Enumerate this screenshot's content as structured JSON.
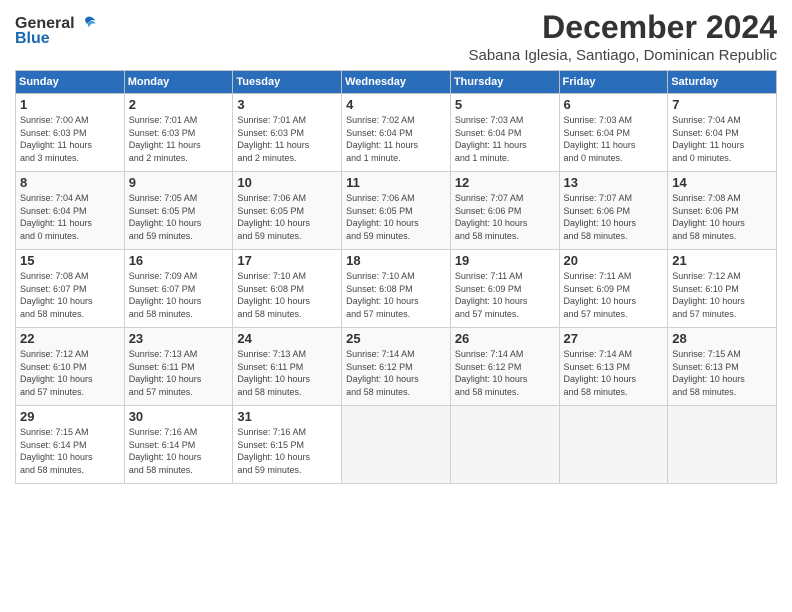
{
  "logo": {
    "general": "General",
    "blue": "Blue"
  },
  "title": "December 2024",
  "subtitle": "Sabana Iglesia, Santiago, Dominican Republic",
  "headers": [
    "Sunday",
    "Monday",
    "Tuesday",
    "Wednesday",
    "Thursday",
    "Friday",
    "Saturday"
  ],
  "weeks": [
    [
      {
        "day": "1",
        "info": "Sunrise: 7:00 AM\nSunset: 6:03 PM\nDaylight: 11 hours\nand 3 minutes."
      },
      {
        "day": "2",
        "info": "Sunrise: 7:01 AM\nSunset: 6:03 PM\nDaylight: 11 hours\nand 2 minutes."
      },
      {
        "day": "3",
        "info": "Sunrise: 7:01 AM\nSunset: 6:03 PM\nDaylight: 11 hours\nand 2 minutes."
      },
      {
        "day": "4",
        "info": "Sunrise: 7:02 AM\nSunset: 6:04 PM\nDaylight: 11 hours\nand 1 minute."
      },
      {
        "day": "5",
        "info": "Sunrise: 7:03 AM\nSunset: 6:04 PM\nDaylight: 11 hours\nand 1 minute."
      },
      {
        "day": "6",
        "info": "Sunrise: 7:03 AM\nSunset: 6:04 PM\nDaylight: 11 hours\nand 0 minutes."
      },
      {
        "day": "7",
        "info": "Sunrise: 7:04 AM\nSunset: 6:04 PM\nDaylight: 11 hours\nand 0 minutes."
      }
    ],
    [
      {
        "day": "8",
        "info": "Sunrise: 7:04 AM\nSunset: 6:04 PM\nDaylight: 11 hours\nand 0 minutes."
      },
      {
        "day": "9",
        "info": "Sunrise: 7:05 AM\nSunset: 6:05 PM\nDaylight: 10 hours\nand 59 minutes."
      },
      {
        "day": "10",
        "info": "Sunrise: 7:06 AM\nSunset: 6:05 PM\nDaylight: 10 hours\nand 59 minutes."
      },
      {
        "day": "11",
        "info": "Sunrise: 7:06 AM\nSunset: 6:05 PM\nDaylight: 10 hours\nand 59 minutes."
      },
      {
        "day": "12",
        "info": "Sunrise: 7:07 AM\nSunset: 6:06 PM\nDaylight: 10 hours\nand 58 minutes."
      },
      {
        "day": "13",
        "info": "Sunrise: 7:07 AM\nSunset: 6:06 PM\nDaylight: 10 hours\nand 58 minutes."
      },
      {
        "day": "14",
        "info": "Sunrise: 7:08 AM\nSunset: 6:06 PM\nDaylight: 10 hours\nand 58 minutes."
      }
    ],
    [
      {
        "day": "15",
        "info": "Sunrise: 7:08 AM\nSunset: 6:07 PM\nDaylight: 10 hours\nand 58 minutes."
      },
      {
        "day": "16",
        "info": "Sunrise: 7:09 AM\nSunset: 6:07 PM\nDaylight: 10 hours\nand 58 minutes."
      },
      {
        "day": "17",
        "info": "Sunrise: 7:10 AM\nSunset: 6:08 PM\nDaylight: 10 hours\nand 58 minutes."
      },
      {
        "day": "18",
        "info": "Sunrise: 7:10 AM\nSunset: 6:08 PM\nDaylight: 10 hours\nand 57 minutes."
      },
      {
        "day": "19",
        "info": "Sunrise: 7:11 AM\nSunset: 6:09 PM\nDaylight: 10 hours\nand 57 minutes."
      },
      {
        "day": "20",
        "info": "Sunrise: 7:11 AM\nSunset: 6:09 PM\nDaylight: 10 hours\nand 57 minutes."
      },
      {
        "day": "21",
        "info": "Sunrise: 7:12 AM\nSunset: 6:10 PM\nDaylight: 10 hours\nand 57 minutes."
      }
    ],
    [
      {
        "day": "22",
        "info": "Sunrise: 7:12 AM\nSunset: 6:10 PM\nDaylight: 10 hours\nand 57 minutes."
      },
      {
        "day": "23",
        "info": "Sunrise: 7:13 AM\nSunset: 6:11 PM\nDaylight: 10 hours\nand 57 minutes."
      },
      {
        "day": "24",
        "info": "Sunrise: 7:13 AM\nSunset: 6:11 PM\nDaylight: 10 hours\nand 58 minutes."
      },
      {
        "day": "25",
        "info": "Sunrise: 7:14 AM\nSunset: 6:12 PM\nDaylight: 10 hours\nand 58 minutes."
      },
      {
        "day": "26",
        "info": "Sunrise: 7:14 AM\nSunset: 6:12 PM\nDaylight: 10 hours\nand 58 minutes."
      },
      {
        "day": "27",
        "info": "Sunrise: 7:14 AM\nSunset: 6:13 PM\nDaylight: 10 hours\nand 58 minutes."
      },
      {
        "day": "28",
        "info": "Sunrise: 7:15 AM\nSunset: 6:13 PM\nDaylight: 10 hours\nand 58 minutes."
      }
    ],
    [
      {
        "day": "29",
        "info": "Sunrise: 7:15 AM\nSunset: 6:14 PM\nDaylight: 10 hours\nand 58 minutes."
      },
      {
        "day": "30",
        "info": "Sunrise: 7:16 AM\nSunset: 6:14 PM\nDaylight: 10 hours\nand 58 minutes."
      },
      {
        "day": "31",
        "info": "Sunrise: 7:16 AM\nSunset: 6:15 PM\nDaylight: 10 hours\nand 59 minutes."
      },
      null,
      null,
      null,
      null
    ]
  ]
}
